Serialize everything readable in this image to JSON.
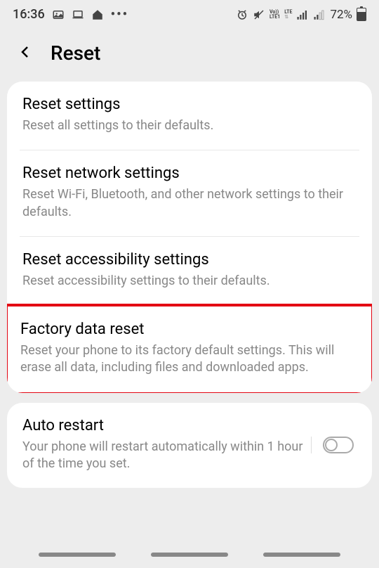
{
  "status": {
    "time": "16:36",
    "battery": "72%",
    "lte_top": "Vo))",
    "lte_bottom": "LTE1",
    "lte2": "LTE"
  },
  "header": {
    "title": "Reset"
  },
  "items": [
    {
      "title": "Reset settings",
      "desc": "Reset all settings to their defaults."
    },
    {
      "title": "Reset network settings",
      "desc": "Reset Wi-Fi, Bluetooth, and other network settings to their defaults."
    },
    {
      "title": "Reset accessibility settings",
      "desc": "Reset accessibility settings to their defaults."
    },
    {
      "title": "Factory data reset",
      "desc": "Reset your phone to its factory default settings. This will erase all data, including files and downloaded apps."
    }
  ],
  "auto_restart": {
    "title": "Auto restart",
    "desc": "Your phone will restart automatically within 1 hour of the time you set."
  }
}
